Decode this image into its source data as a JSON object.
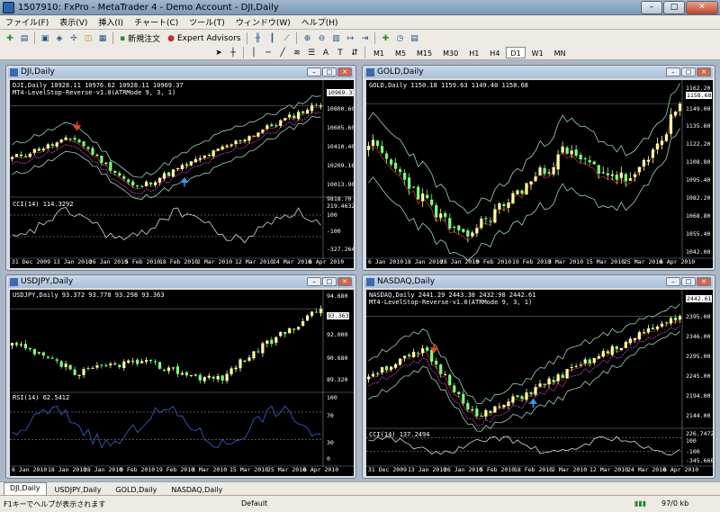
{
  "app": {
    "title": "1507910: FxPro - MetaTrader 4 - Demo Account - DJI,Daily"
  },
  "window_buttons": {
    "minimize": "–",
    "maximize": "□",
    "close": "✕"
  },
  "menu": [
    "ファイル(F)",
    "表示(V)",
    "挿入(I)",
    "チャート(C)",
    "ツール(T)",
    "ウィンドウ(W)",
    "ヘルプ(H)"
  ],
  "toolbar": {
    "new_order": "新規注文",
    "expert_advisors": "Expert Advisors",
    "timeframes": [
      "M1",
      "M5",
      "M15",
      "M30",
      "H1",
      "H4",
      "D1",
      "W1",
      "MN"
    ],
    "active_timeframe": "D1"
  },
  "charts": {
    "dji": {
      "title": "DJI,Daily",
      "ohlc": "DJI,Daily  10928.11 10976.62 10928.11 10969.37",
      "indicator": "MT4-LevelStop-Reverse-v1.0(ATRMode 9, 3, 1)",
      "sub": "CCI(14) 114.3292",
      "price_tag": "10969.37",
      "axis": [
        "10800.60",
        "10605.60",
        "10410.40",
        "10209.16",
        "10013.90",
        "9818.70"
      ],
      "sub_axis": [
        "219.4632",
        "100",
        "-100",
        "-327.264"
      ],
      "dates": [
        "31 Dec 2009",
        "13 Jan 2010",
        "26 Jan 2010",
        "5 Feb 2010",
        "18 Feb 2010",
        "2 Mar 2010",
        "12 Mar 2010",
        "24 Mar 2010",
        "6 Apr 2010"
      ]
    },
    "gold": {
      "title": "GOLD,Daily",
      "ohlc": "GOLD,Daily  1150.18 1159.63 1149.40 1158.68",
      "price_tag": "1158.68",
      "axis": [
        "1162.20",
        "1149.00",
        "1135.60",
        "1122.20",
        "1108.80",
        "1095.40",
        "1082.20",
        "1068.80",
        "1055.40",
        "1042.00"
      ],
      "dates": [
        "6 Jan 2010",
        "18 Jan 2010",
        "28 Jan 2010",
        "9 Feb 2010",
        "19 Feb 2010",
        "3 Mar 2010",
        "15 Mar 2010",
        "25 Mar 2010",
        "6 Apr 2010"
      ]
    },
    "usdjpy": {
      "title": "USDJPY,Daily",
      "ohlc": "USDJPY,Daily  93.372 93.778 93.298 93.363",
      "sub": "RSI(14) 62.5412",
      "price_tag": "93.363",
      "axis": [
        "94.680",
        "92.000",
        "90.680",
        "89.320"
      ],
      "sub_axis": [
        "100",
        "70",
        "30",
        "0"
      ],
      "dates": [
        "6 Jan 2010",
        "18 Jan 2010",
        "28 Jan 2010",
        "9 Feb 2010",
        "19 Feb 2010",
        "3 Mar 2010",
        "15 Mar 2010",
        "25 Mar 2010",
        "6 Apr 2010"
      ]
    },
    "nasdaq": {
      "title": "NASDAQ,Daily",
      "ohlc": "NASDAQ,Daily  2441.29 2443.38 2432.98 2442.61",
      "indicator": "MT4-LevelStop-Reverse-v1.0(ATRMode 9, 3, 1)",
      "sub": "CCI(14) 137.2494",
      "price_tag": "2442.61",
      "axis": [
        "2395.00",
        "2346.00",
        "2295.00",
        "2245.00",
        "2194.00",
        "2144.00"
      ],
      "sub_axis": [
        "226.7472",
        "100",
        "-100",
        "-345.666"
      ],
      "dates": [
        "31 Dec 2009",
        "13 Jan 2010",
        "26 Jan 2010",
        "5 Feb 2010",
        "18 Feb 2010",
        "2 Mar 2010",
        "12 Mar 2010",
        "24 Mar 2010",
        "6 Apr 2010"
      ]
    }
  },
  "tabs": [
    "DJI,Daily",
    "USDJPY,Daily",
    "GOLD,Daily",
    "NASDAQ,Daily"
  ],
  "status": {
    "help": "F1キーでヘルプが表示されます",
    "profile": "Default",
    "traffic": "97/0 kb"
  },
  "colors": {
    "bull": "#ffffa0",
    "bear": "#7dff7d",
    "band": "#9fd3b4",
    "ma": "#c03030",
    "stop": "#d040d0",
    "buy_arrow": "#3a9cf0",
    "sell_arrow": "#ff4020"
  }
}
